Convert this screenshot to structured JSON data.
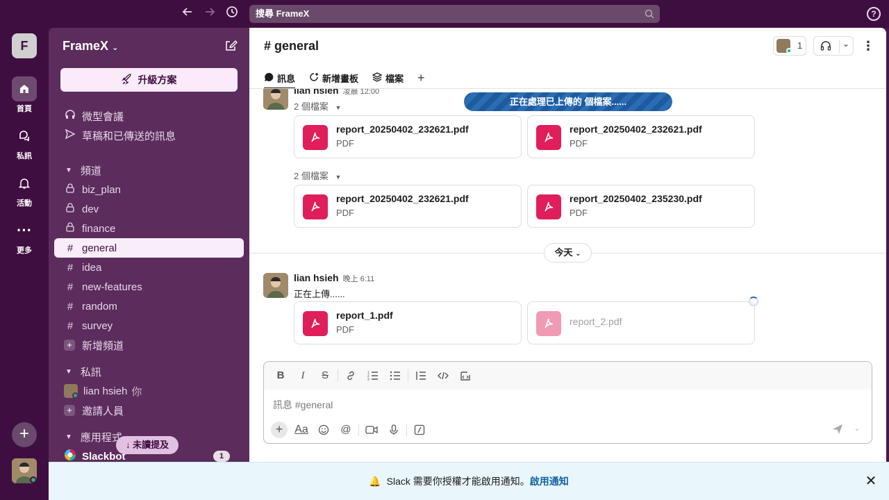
{
  "topbar": {
    "search_placeholder": "搜尋 FrameX",
    "help_label": "?"
  },
  "rail": {
    "workspace_initial": "F",
    "items": [
      {
        "label": "首頁",
        "icon": "home-icon"
      },
      {
        "label": "私訊",
        "icon": "chat-bubbles-icon"
      },
      {
        "label": "活動",
        "icon": "bell-icon"
      },
      {
        "label": "更多",
        "icon": "more-icon"
      }
    ],
    "add_label": "+"
  },
  "sidebar": {
    "workspace_name": "FrameX",
    "upgrade_label": "升級方案",
    "quick_links": [
      {
        "label": "微型會議",
        "icon": "headphones-icon"
      },
      {
        "label": "草稿和已傳送的訊息",
        "icon": "send-icon"
      }
    ],
    "channels_header": "頻道",
    "channels": [
      {
        "name": "biz_plan",
        "private": true
      },
      {
        "name": "dev",
        "private": true
      },
      {
        "name": "finance",
        "private": true
      },
      {
        "name": "general",
        "private": false,
        "active": true
      },
      {
        "name": "idea",
        "private": false
      },
      {
        "name": "new-features",
        "private": false
      },
      {
        "name": "random",
        "private": false
      },
      {
        "name": "survey",
        "private": false
      }
    ],
    "add_channel_label": "新增頻道",
    "dms_header": "私訊",
    "dm_user": "lian hsieh",
    "dm_you_suffix": "你",
    "invite_label": "邀請人員",
    "apps_header": "應用程式",
    "unread_mentions_label": "未讀提及",
    "slackbot_label": "Slackbot",
    "slackbot_count": "1"
  },
  "main": {
    "channel_title": "# general",
    "member_count": "1",
    "tabs": [
      {
        "label": "訊息",
        "active": true
      },
      {
        "label": "新增畫板"
      },
      {
        "label": "檔案"
      }
    ],
    "tab_add_label": "+",
    "processing_banner": "正在處理已上傳的 個檔案......",
    "messages": [
      {
        "sender": "lian hsieh",
        "time": "凌晨 12:00",
        "groups": [
          {
            "toggle": "2 個檔案",
            "files": [
              {
                "name": "report_20250402_232621.pdf",
                "type": "PDF"
              },
              {
                "name": "report_20250402_232621.pdf",
                "type": "PDF"
              }
            ]
          },
          {
            "toggle": "2 個檔案",
            "files": [
              {
                "name": "report_20250402_232621.pdf",
                "type": "PDF"
              },
              {
                "name": "report_20250402_235230.pdf",
                "type": "PDF"
              }
            ]
          }
        ]
      }
    ],
    "day_divider": "今天",
    "latest_message": {
      "sender": "lian hsieh",
      "time": "晚上 6:11",
      "text": "正在上傳......",
      "files": [
        {
          "name": "report_1.pdf",
          "type": "PDF"
        },
        {
          "name": "report_2.pdf",
          "type": ""
        }
      ]
    },
    "composer": {
      "placeholder": "訊息 #general"
    }
  },
  "notification": {
    "text": "Slack 需要你授權才能啟用通知。",
    "link": "啟用通知",
    "close_label": "✕"
  },
  "colors": {
    "sidebar_bg": "#5b2c5c",
    "rail_bg": "#3f0e40",
    "pdf_red": "#e01e5a",
    "link_blue": "#1264a3"
  }
}
